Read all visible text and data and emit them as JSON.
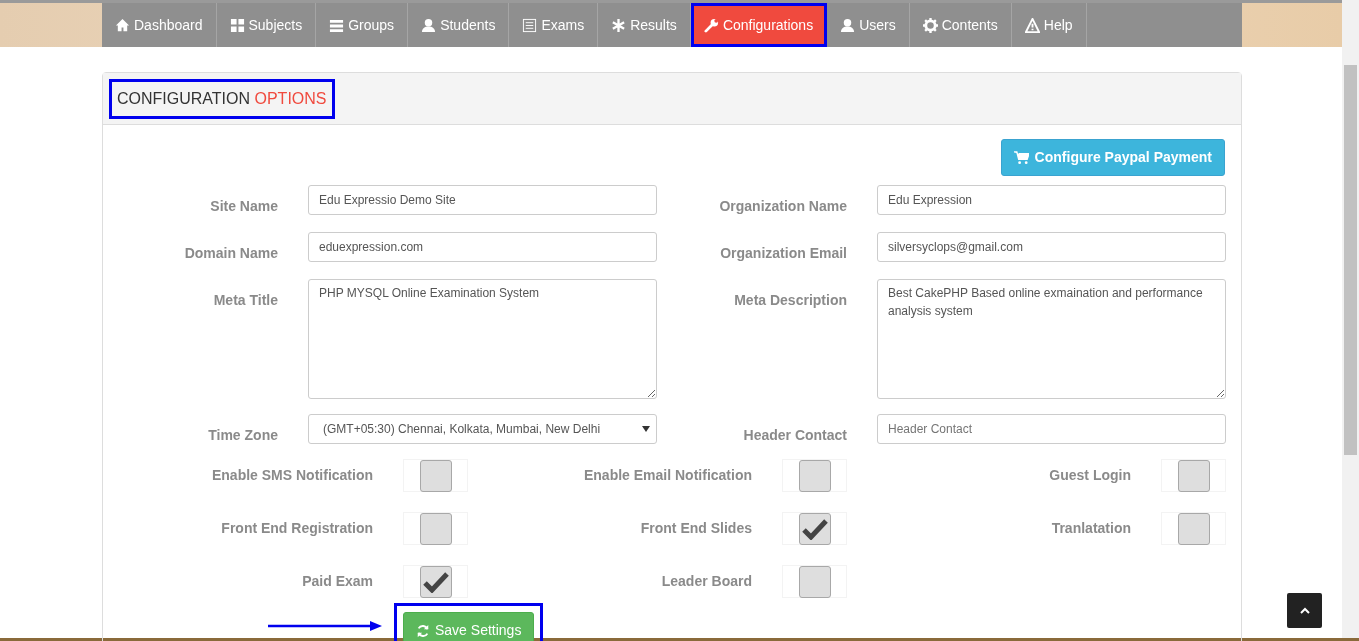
{
  "nav": [
    {
      "label": "Dashboard",
      "selected": false,
      "highlighted": false
    },
    {
      "label": "Subjects",
      "selected": false,
      "highlighted": false
    },
    {
      "label": "Groups",
      "selected": false,
      "highlighted": false
    },
    {
      "label": "Students",
      "selected": false,
      "highlighted": false
    },
    {
      "label": "Exams",
      "selected": false,
      "highlighted": false
    },
    {
      "label": "Results",
      "selected": false,
      "highlighted": false
    },
    {
      "label": "Configurations",
      "selected": true,
      "highlighted": true
    },
    {
      "label": "Users",
      "selected": false,
      "highlighted": false
    },
    {
      "label": "Contents",
      "selected": false,
      "highlighted": false
    },
    {
      "label": "Help",
      "selected": false,
      "highlighted": false
    }
  ],
  "heading": {
    "text": "CONFIGURATION",
    "accent": "OPTIONS",
    "highlighted": true
  },
  "paypal_button": {
    "label": "Configure Paypal Payment"
  },
  "fields": [
    {
      "label": "Site Name",
      "kind": "text",
      "value": "Edu Expressio Demo Site"
    },
    {
      "label": "Organization Name",
      "kind": "text",
      "value": "Edu Expression"
    },
    {
      "label": "Domain Name",
      "kind": "text",
      "value": "eduexpression.com"
    },
    {
      "label": "Organization Email",
      "kind": "text",
      "value": "silversyclops@gmail.com"
    },
    {
      "label": "Meta Title",
      "kind": "textarea",
      "value": "PHP MYSQL Online Examination System"
    },
    {
      "label": "Meta Description",
      "kind": "textarea",
      "value": "Best CakePHP Based online exmaination and performance analysis system"
    },
    {
      "label": "Time Zone",
      "kind": "select",
      "value": "(GMT+05:30) Chennai, Kolkata, Mumbai, New Delhi"
    },
    {
      "label": "Header Contact",
      "kind": "text",
      "placeholder": "Header Contact"
    }
  ],
  "options": [
    {
      "label": "Enable SMS Notification",
      "checked": false
    },
    {
      "label": "Enable Email Notification",
      "checked": false
    },
    {
      "label": "Guest Login",
      "checked": false
    },
    {
      "label": "Front End Registration",
      "checked": false
    },
    {
      "label": "Front End Slides",
      "checked": true
    },
    {
      "label": "Tranlatation",
      "checked": false
    },
    {
      "label": "Paid Exam",
      "checked": true
    },
    {
      "label": "Leader Board",
      "checked": false
    }
  ],
  "save_button": {
    "label": "Save Settings",
    "highlighted": true
  },
  "pointer_arrow": true
}
